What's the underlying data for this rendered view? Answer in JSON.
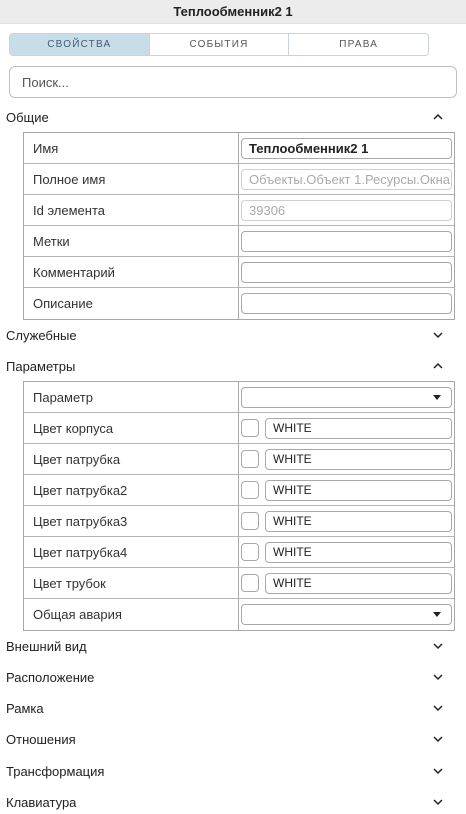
{
  "window": {
    "title": "Теплообменник2 1"
  },
  "tabs": [
    {
      "label": "СВОЙСТВА",
      "active": true
    },
    {
      "label": "СОБЫТИЯ",
      "active": false
    },
    {
      "label": "ПРАВА",
      "active": false
    }
  ],
  "search": {
    "placeholder": "Поиск..."
  },
  "sections": {
    "general": {
      "label": "Общие",
      "expanded": true,
      "rows": {
        "name": {
          "label": "Имя",
          "value": "Теплообменник2 1"
        },
        "full_name": {
          "label": "Полное имя",
          "value": "Объекты.Объект 1.Ресурсы.Окна"
        },
        "element_id": {
          "label": "Id элемента",
          "value": "39306"
        },
        "tags": {
          "label": "Метки",
          "value": ""
        },
        "comment": {
          "label": "Комментарий",
          "value": ""
        },
        "description": {
          "label": "Описание",
          "value": ""
        }
      }
    },
    "service": {
      "label": "Служебные",
      "expanded": false
    },
    "parameters": {
      "label": "Параметры",
      "expanded": true,
      "rows": {
        "parameter": {
          "label": "Параметр",
          "value": ""
        },
        "body_color": {
          "label": "Цвет корпуса",
          "value": "WHITE"
        },
        "pipe_color": {
          "label": "Цвет патрубка",
          "value": "WHITE"
        },
        "pipe_color2": {
          "label": "Цвет патрубка2",
          "value": "WHITE"
        },
        "pipe_color3": {
          "label": "Цвет патрубка3",
          "value": "WHITE"
        },
        "pipe_color4": {
          "label": "Цвет патрубка4",
          "value": "WHITE"
        },
        "tube_color": {
          "label": "Цвет трубок",
          "value": "WHITE"
        },
        "general_alarm": {
          "label": "Общая авария",
          "value": ""
        }
      }
    },
    "appearance": {
      "label": "Внешний вид",
      "expanded": false
    },
    "position": {
      "label": "Расположение",
      "expanded": false
    },
    "frame": {
      "label": "Рамка",
      "expanded": false
    },
    "relations": {
      "label": "Отношения",
      "expanded": false
    },
    "transform": {
      "label": "Трансформация",
      "expanded": false
    },
    "keyboard": {
      "label": "Клавиатура",
      "expanded": false
    }
  },
  "icons": {
    "expanded": "chevron-up-icon",
    "collapsed": "chevron-down-icon",
    "dropdown": "caret-down-icon"
  },
  "colors": {
    "active_tab_bg": "#c9dde8",
    "active_tab_text": "#3b5f78",
    "border": "#a8a8a8"
  }
}
